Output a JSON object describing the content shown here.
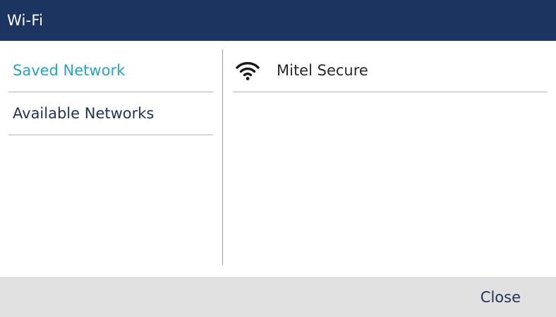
{
  "header": {
    "title": "Wi-Fi",
    "background_color": "#1b3460"
  },
  "sidebar": {
    "items": [
      {
        "label": "Saved Network",
        "selected": true
      },
      {
        "label": "Available Networks",
        "selected": false
      }
    ],
    "selected_color": "#2aa3c9",
    "text_color": "#1f3458"
  },
  "networks": [
    {
      "name": "Mitel Secure",
      "icon": "wifi-icon"
    }
  ],
  "footer": {
    "close_label": "Close",
    "background_color": "#e1e1e1"
  }
}
